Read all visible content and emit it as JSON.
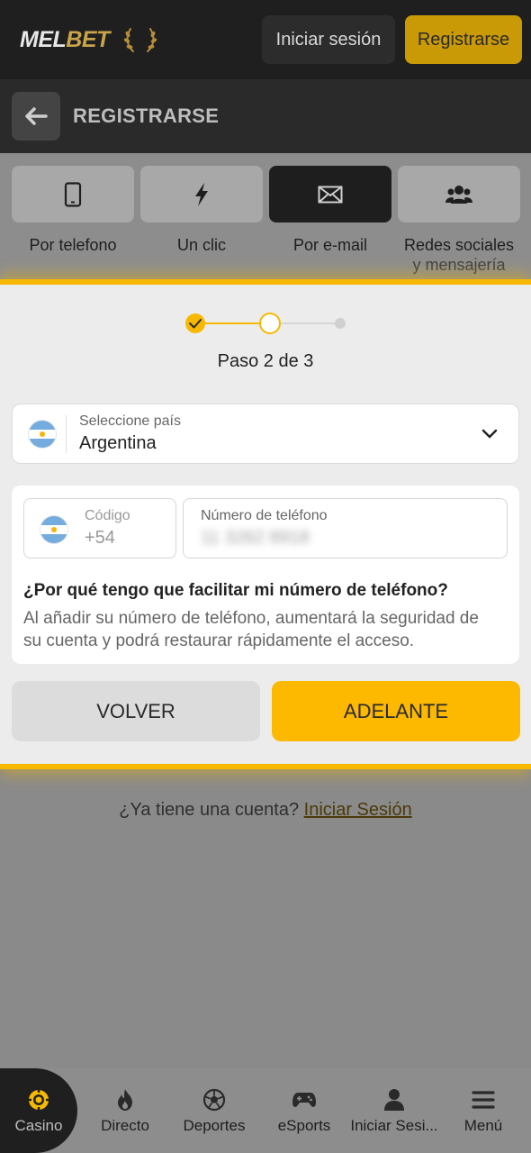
{
  "header": {
    "logo_left": "MEL",
    "logo_right": "BET",
    "login_label": "Iniciar sesión",
    "register_label": "Registrarse"
  },
  "subheader": {
    "title": "REGISTRARSE"
  },
  "methods": [
    {
      "label": "Por telefono",
      "icon": "phone-icon"
    },
    {
      "label": "Un clic",
      "icon": "lightning-icon"
    },
    {
      "label": "Por e-mail",
      "icon": "envelope-icon",
      "active": true
    },
    {
      "label": "Redes sociales",
      "label2": "y mensajería",
      "icon": "users-icon"
    }
  ],
  "stepper": {
    "label": "Paso 2 de 3",
    "current": 2,
    "total": 3
  },
  "country": {
    "label": "Seleccione país",
    "value": "Argentina"
  },
  "phone": {
    "code_label": "Código",
    "code_value": "+54",
    "number_label": "Número de teléfono",
    "number_value": "11 3262 8918"
  },
  "info": {
    "title": "¿Por qué tengo que facilitar mi número de teléfono?",
    "text": "Al añadir su número de teléfono, aumentará la seguridad de su cuenta y podrá restaurar rápidamente el acceso."
  },
  "actions": {
    "back_label": "VOLVER",
    "next_label": "ADELANTE"
  },
  "account": {
    "question": "¿Ya tiene una cuenta?",
    "link": "Iniciar Sesión"
  },
  "bottom_nav": [
    {
      "label": "Casino",
      "icon": "casino-chip-icon",
      "active": true
    },
    {
      "label": "Directo",
      "icon": "flame-icon"
    },
    {
      "label": "Deportes",
      "icon": "soccer-ball-icon"
    },
    {
      "label": "eSports",
      "icon": "gamepad-icon"
    },
    {
      "label": "Iniciar Sesi...",
      "icon": "user-icon"
    },
    {
      "label": "Menú",
      "icon": "hamburger-menu-icon"
    }
  ],
  "colors": {
    "accent": "#fcb900",
    "dark": "#1f1f1f"
  }
}
